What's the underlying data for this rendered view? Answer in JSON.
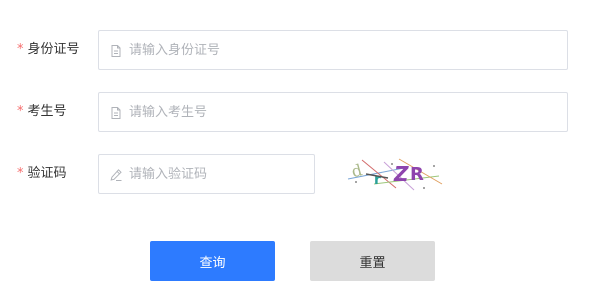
{
  "form": {
    "id_card": {
      "required_mark": "*",
      "label": "身份证号",
      "placeholder": "请输入身份证号",
      "value": "",
      "icon": "document-icon"
    },
    "exam_number": {
      "required_mark": "*",
      "label": "考生号",
      "placeholder": "请输入考生号",
      "value": "",
      "icon": "document-icon"
    },
    "captcha": {
      "required_mark": "*",
      "label": "验证码",
      "placeholder": "请输入验证码",
      "value": "",
      "icon": "pencil-icon",
      "image_text": "d r ZR"
    }
  },
  "buttons": {
    "query_label": "查询",
    "reset_label": "重置"
  },
  "colors": {
    "primary": "#2d7bff",
    "reset_bg": "#dcdcdc",
    "required": "#f56c6c",
    "border": "#dcdfe6",
    "captcha_purple": "#8e44ad",
    "captcha_teal": "#2aa198"
  }
}
